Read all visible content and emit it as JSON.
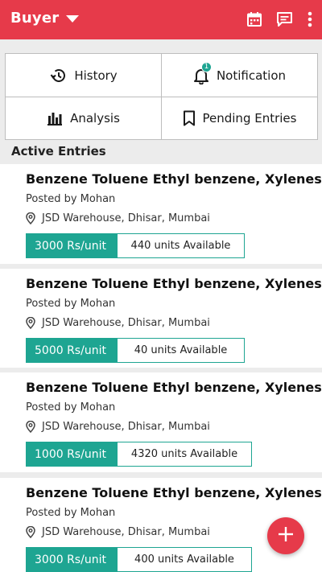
{
  "appbar": {
    "title": "Buyer",
    "icons": [
      "calendar-icon",
      "chat-icon",
      "more-vertical-icon"
    ]
  },
  "menu": {
    "history": "History",
    "notification": "Notification",
    "notification_badge": "1",
    "analysis": "Analysis",
    "pending": "Pending Entries"
  },
  "section_title": "Active Entries",
  "entries": [
    {
      "title": "Benzene Toluene Ethyl benzene, Xylenes,",
      "posted": "Posted by Mohan",
      "location": "JSD Warehouse, Dhisar, Mumbai",
      "price": "3000 Rs/unit",
      "available": "440 units Available"
    },
    {
      "title": "Benzene Toluene Ethyl benzene, Xylenes,",
      "posted": "Posted by Mohan",
      "location": "JSD Warehouse, Dhisar, Mumbai",
      "price": "5000 Rs/unit",
      "available": "40 units Available"
    },
    {
      "title": "Benzene Toluene Ethyl benzene, Xylenes,",
      "posted": "Posted by Mohan",
      "location": "JSD Warehouse, Dhisar, Mumbai",
      "price": "1000 Rs/unit",
      "available": "4320 units Available"
    },
    {
      "title": "Benzene Toluene Ethyl benzene, Xylenes,",
      "posted": "Posted by Mohan",
      "location": "JSD Warehouse, Dhisar, Mumbai",
      "price": "3000 Rs/unit",
      "available": "400 units Available"
    }
  ],
  "colors": {
    "primary": "#e63a4a",
    "accent": "#1ea592"
  }
}
